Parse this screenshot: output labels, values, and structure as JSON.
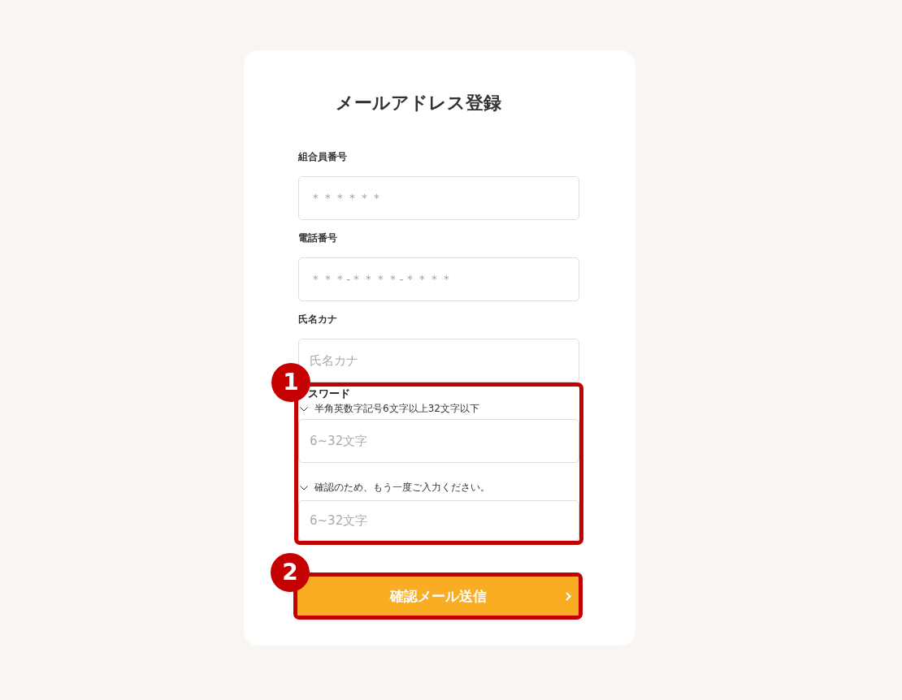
{
  "title": "メールアドレス登録",
  "fields": [
    {
      "label": "組合員番号",
      "placeholder": "＊＊＊＊＊＊"
    },
    {
      "label": "電話番号",
      "placeholder": "＊＊＊-＊＊＊＊-＊＊＊＊"
    },
    {
      "label": "氏名カナ",
      "placeholder": "氏名カナ"
    }
  ],
  "password": {
    "annotation": "1",
    "label": "スワード",
    "fields": [
      {
        "hint": "半角英数字記号6文字以上32文字以下",
        "placeholder": "6~32文字"
      },
      {
        "hint": "確認のため、もう一度ご入力ください。",
        "placeholder": "6~32文字"
      }
    ]
  },
  "submit_button": {
    "annotation": "2",
    "label": "確認メール送信"
  }
}
